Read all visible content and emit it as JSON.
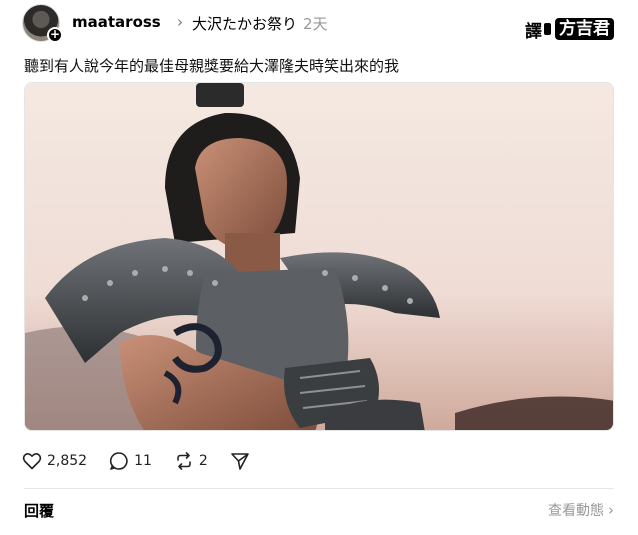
{
  "post": {
    "author": "maataross",
    "community": "大沢たかお祭り",
    "time_ago": "2天",
    "text": "聽到有人說今年的最佳母親獎要給大澤隆夫時笑出來的我",
    "watermark": "譯 方吉君"
  },
  "actions": {
    "likes": "2,852",
    "replies": "11",
    "reposts": "2"
  },
  "footer": {
    "reply_label": "回覆",
    "view_activity": "查看動態"
  },
  "icons": {
    "like": "heart-icon",
    "reply": "comment-icon",
    "repost": "repost-icon",
    "share": "send-icon",
    "follow": "plus-icon",
    "chevron": "chevron-right-icon"
  }
}
